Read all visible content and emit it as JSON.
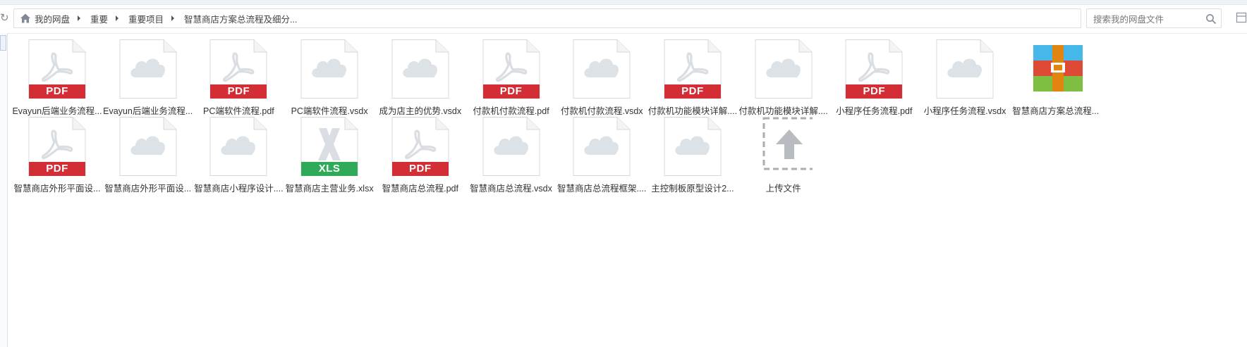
{
  "breadcrumb": [
    "我的网盘",
    "重要",
    "重要项目",
    "智慧商店方案总流程及细分..."
  ],
  "search": {
    "placeholder": "搜索我的网盘文件"
  },
  "colors": {
    "pdf": "#d32d36",
    "xls": "#2eaa59",
    "cloud": "#dde2e7",
    "archive_top": "#45b7e9",
    "archive_mid": "#df4a37",
    "archive_bottom": "#7ebf41",
    "archive_strap": "#e28410"
  },
  "files": [
    {
      "name": "Evayun后端业务流程...",
      "kind": "pdf",
      "badge": "PDF",
      "icon": "pdf-icon"
    },
    {
      "name": "Evayun后端业务流程...",
      "kind": "cloud",
      "icon": "cloud-file-icon"
    },
    {
      "name": "PC端软件流程.pdf",
      "kind": "pdf",
      "badge": "PDF",
      "icon": "pdf-icon"
    },
    {
      "name": "PC端软件流程.vsdx",
      "kind": "cloud",
      "icon": "cloud-file-icon"
    },
    {
      "name": "成为店主的优势.vsdx",
      "kind": "cloud",
      "icon": "cloud-file-icon"
    },
    {
      "name": "付款机付款流程.pdf",
      "kind": "pdf",
      "badge": "PDF",
      "icon": "pdf-icon"
    },
    {
      "name": "付款机付款流程.vsdx",
      "kind": "cloud",
      "icon": "cloud-file-icon"
    },
    {
      "name": "付款机功能模块详解....",
      "kind": "pdf",
      "badge": "PDF",
      "icon": "pdf-icon"
    },
    {
      "name": "付款机功能模块详解....",
      "kind": "cloud",
      "icon": "cloud-file-icon"
    },
    {
      "name": "小程序任务流程.pdf",
      "kind": "pdf",
      "badge": "PDF",
      "icon": "pdf-icon"
    },
    {
      "name": "小程序任务流程.vsdx",
      "kind": "cloud",
      "icon": "cloud-file-icon"
    },
    {
      "name": "智慧商店方案总流程...",
      "kind": "archive",
      "icon": "archive-icon"
    },
    {
      "name": "智慧商店外形平面设...",
      "kind": "pdf",
      "badge": "PDF",
      "icon": "pdf-icon"
    },
    {
      "name": "智慧商店外形平面设...",
      "kind": "cloud",
      "icon": "cloud-file-icon"
    },
    {
      "name": "智慧商店小程序设计....",
      "kind": "cloud",
      "icon": "cloud-file-icon"
    },
    {
      "name": "智慧商店主营业务.xlsx",
      "kind": "xls",
      "badge": "XLS",
      "icon": "xls-icon"
    },
    {
      "name": "智慧商店总流程.pdf",
      "kind": "pdf",
      "badge": "PDF",
      "icon": "pdf-icon"
    },
    {
      "name": "智慧商店总流程.vsdx",
      "kind": "cloud",
      "icon": "cloud-file-icon"
    },
    {
      "name": "智慧商店总流程框架....",
      "kind": "cloud",
      "icon": "cloud-file-icon"
    },
    {
      "name": "主控制板原型设计2...",
      "kind": "cloud",
      "icon": "cloud-file-icon"
    },
    {
      "name": "上传文件",
      "kind": "upload",
      "icon": "upload-icon"
    }
  ]
}
